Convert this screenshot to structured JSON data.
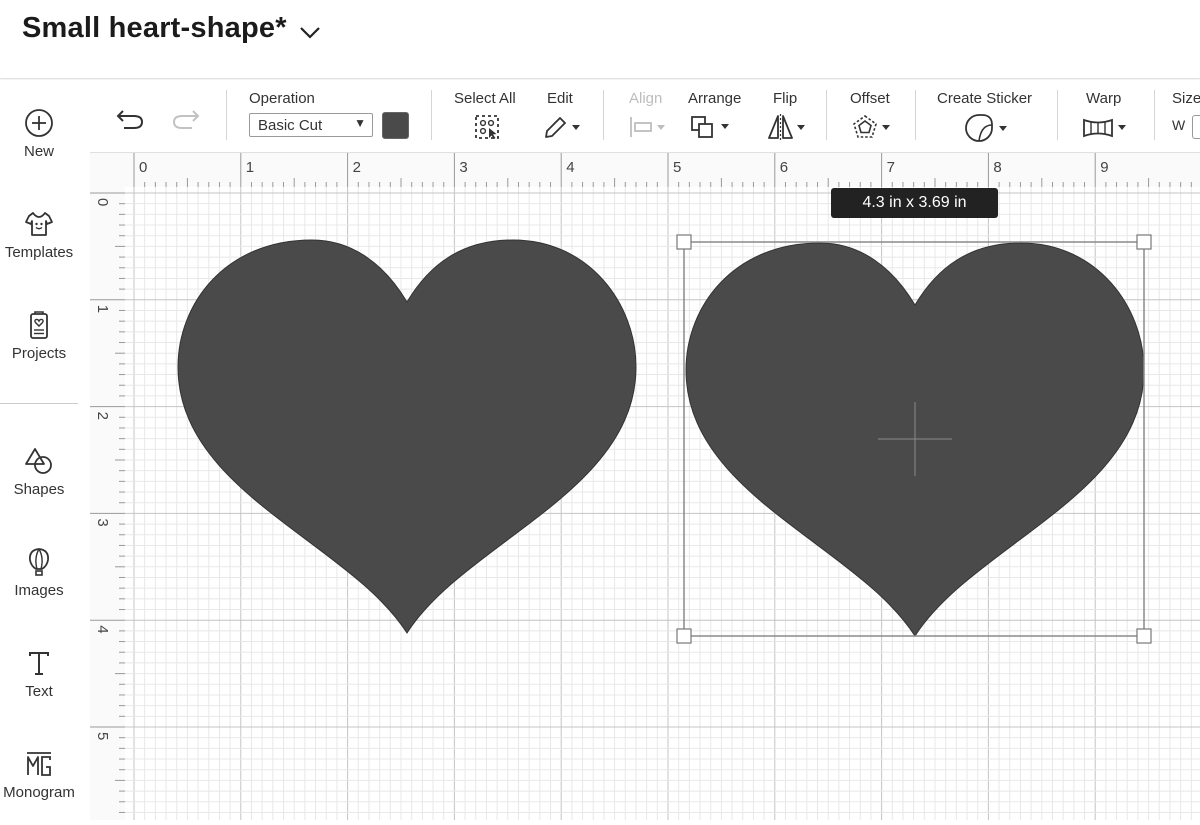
{
  "project": {
    "title": "Small heart-shape*"
  },
  "sidebar": {
    "items": [
      {
        "label": "New",
        "icon": "plus-circle-icon"
      },
      {
        "label": "Templates",
        "icon": "shirt-icon"
      },
      {
        "label": "Projects",
        "icon": "projects-icon"
      },
      {
        "label": "Shapes",
        "icon": "shapes-icon"
      },
      {
        "label": "Images",
        "icon": "balloon-icon"
      },
      {
        "label": "Text",
        "icon": "text-t-icon"
      },
      {
        "label": "Monogram",
        "icon": "monogram-icon"
      }
    ]
  },
  "toolbar": {
    "operation_label": "Operation",
    "operation_value": "Basic Cut",
    "operation_color": "#4a4a4a",
    "select_all_label": "Select All",
    "edit_label": "Edit",
    "align_label": "Align",
    "arrange_label": "Arrange",
    "flip_label": "Flip",
    "offset_label": "Offset",
    "create_sticker_label": "Create Sticker",
    "warp_label": "Warp",
    "size_label": "Size",
    "size_w_label": "W"
  },
  "rulers": {
    "horizontal": [
      "0",
      "1",
      "2",
      "3",
      "4",
      "5",
      "6",
      "7",
      "8",
      "9"
    ],
    "vertical": [
      "0",
      "1",
      "2",
      "3",
      "4",
      "5"
    ]
  },
  "canvas": {
    "selection_size": "4.3  in x 3.69  in",
    "shape_color": "#4a4a4a",
    "shapes": [
      "heart-left",
      "heart-right"
    ]
  }
}
